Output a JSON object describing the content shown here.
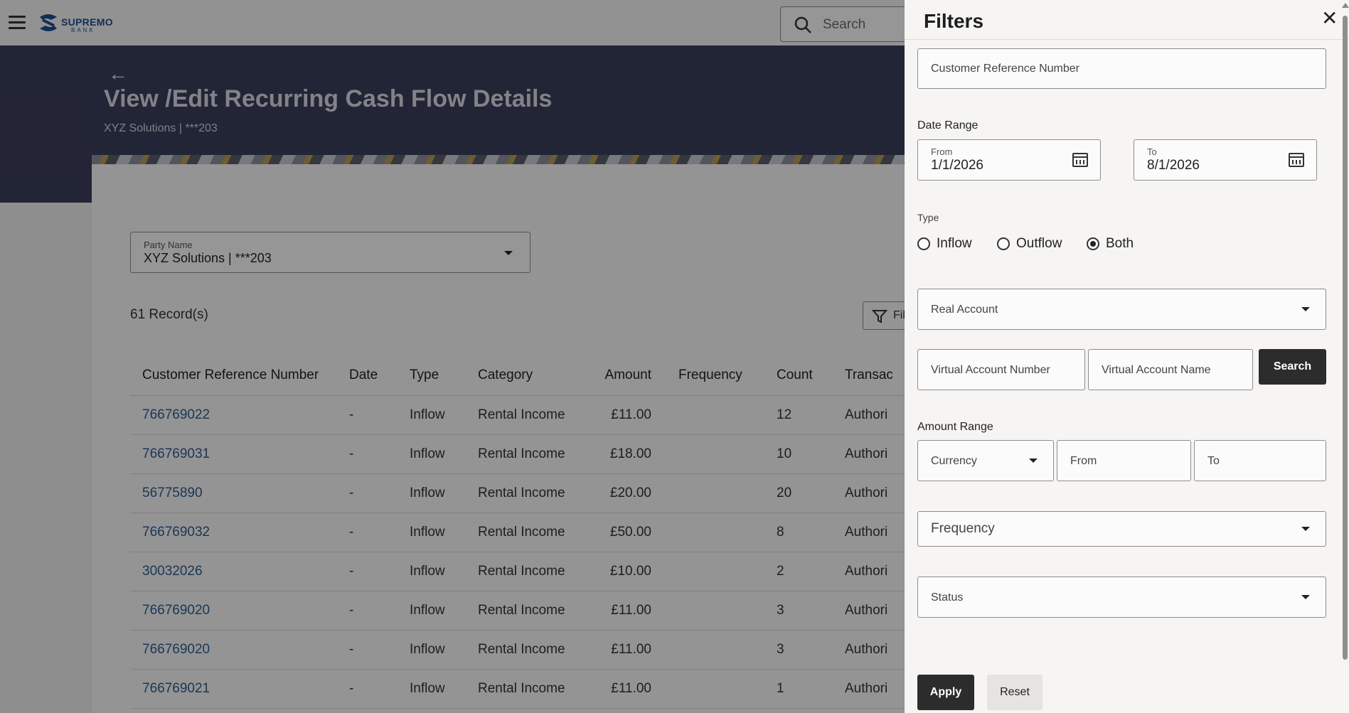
{
  "header": {
    "logo_text": "SUPREMO",
    "logo_sub": "BANK",
    "search_placeholder": "Search"
  },
  "page": {
    "title": "View /Edit Recurring Cash Flow Details",
    "subtitle": "XYZ Solutions | ***203"
  },
  "party": {
    "label": "Party Name",
    "value": "XYZ Solutions | ***203"
  },
  "records_count": "61 Record(s)",
  "filter_button_label": "Fil",
  "table": {
    "headers": [
      "Customer Reference Number",
      "Date",
      "Type",
      "Category",
      "Amount",
      "Frequency",
      "Count",
      "Transac"
    ],
    "rows": [
      {
        "ref": "766769022",
        "date": "-",
        "type": "Inflow",
        "category": "Rental Income",
        "amount": "£11.00",
        "frequency": "",
        "count": "12",
        "status": "Authori"
      },
      {
        "ref": "766769031",
        "date": "-",
        "type": "Inflow",
        "category": "Rental Income",
        "amount": "£18.00",
        "frequency": "",
        "count": "10",
        "status": "Authori"
      },
      {
        "ref": "56775890",
        "date": "-",
        "type": "Inflow",
        "category": "Rental Income",
        "amount": "£20.00",
        "frequency": "",
        "count": "20",
        "status": "Authori"
      },
      {
        "ref": "766769032",
        "date": "-",
        "type": "Inflow",
        "category": "Rental Income",
        "amount": "£50.00",
        "frequency": "",
        "count": "8",
        "status": "Authori"
      },
      {
        "ref": "30032026",
        "date": "-",
        "type": "Inflow",
        "category": "Rental Income",
        "amount": "£10.00",
        "frequency": "",
        "count": "2",
        "status": "Authori"
      },
      {
        "ref": "766769020",
        "date": "-",
        "type": "Inflow",
        "category": "Rental Income",
        "amount": "£11.00",
        "frequency": "",
        "count": "3",
        "status": "Authori"
      },
      {
        "ref": "766769020",
        "date": "-",
        "type": "Inflow",
        "category": "Rental Income",
        "amount": "£11.00",
        "frequency": "",
        "count": "3",
        "status": "Authori"
      },
      {
        "ref": "766769021",
        "date": "-",
        "type": "Inflow",
        "category": "Rental Income",
        "amount": "£11.00",
        "frequency": "",
        "count": "1",
        "status": "Authori"
      }
    ]
  },
  "filters": {
    "title": "Filters",
    "close": "✕",
    "customer_ref_placeholder": "Customer Reference Number",
    "date_range_label": "Date Range",
    "from_label": "From",
    "from_value": "1/1/2026",
    "to_label": "To",
    "to_value": "8/1/2026",
    "type_label": "Type",
    "type_options": [
      "Inflow",
      "Outflow",
      "Both"
    ],
    "type_selected": "Both",
    "real_account_placeholder": "Real Account",
    "virtual_account_number_placeholder": "Virtual Account Number",
    "virtual_account_name_placeholder": "Virtual Account Name",
    "search_button": "Search",
    "amount_range_label": "Amount Range",
    "currency_placeholder": "Currency",
    "amount_from_placeholder": "From",
    "amount_to_placeholder": "To",
    "frequency_placeholder": "Frequency",
    "status_placeholder": "Status",
    "apply_button": "Apply",
    "reset_button": "Reset"
  },
  "colors": {
    "banner": "#3a3e5a",
    "link": "#2e5c8f",
    "dark_button": "#2c2c2c",
    "logo": "#1d4f91"
  }
}
